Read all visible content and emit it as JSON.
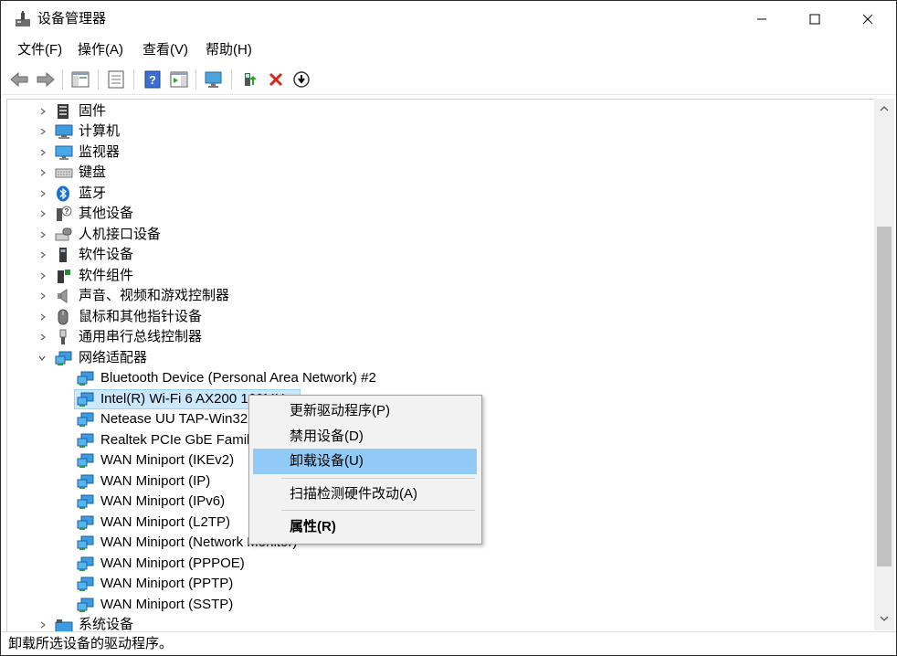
{
  "window": {
    "title": "设备管理器"
  },
  "menu": [
    {
      "label": "文件(F)"
    },
    {
      "label": "操作(A)"
    },
    {
      "label": "查看(V)"
    },
    {
      "label": "帮助(H)"
    }
  ],
  "toolbar": {
    "icons": [
      "back-icon",
      "forward-icon",
      "show-hide-tree-icon",
      "properties-icon",
      "help-icon",
      "action-pane-icon",
      "monitor-scan-icon",
      "update-driver-icon",
      "uninstall-icon",
      "disable-icon"
    ]
  },
  "tree": {
    "categories_top": [
      {
        "label": "固件",
        "icon": "firmware-icon"
      },
      {
        "label": "计算机",
        "icon": "computer-icon"
      },
      {
        "label": "监视器",
        "icon": "monitor-icon"
      },
      {
        "label": "键盘",
        "icon": "keyboard-icon"
      },
      {
        "label": "蓝牙",
        "icon": "bluetooth-icon"
      },
      {
        "label": "其他设备",
        "icon": "unknown-device-icon"
      },
      {
        "label": "人机接口设备",
        "icon": "hid-icon"
      },
      {
        "label": "软件设备",
        "icon": "software-device-icon"
      },
      {
        "label": "软件组件",
        "icon": "software-component-icon"
      },
      {
        "label": "声音、视频和游戏控制器",
        "icon": "speaker-icon"
      },
      {
        "label": "鼠标和其他指针设备",
        "icon": "mouse-icon"
      },
      {
        "label": "通用串行总线控制器",
        "icon": "usb-icon"
      }
    ],
    "network": {
      "label": "网络适配器",
      "children": [
        {
          "label": "Bluetooth Device (Personal Area Network) #2"
        },
        {
          "label": "Intel(R) Wi-Fi 6 AX200 160MHz"
        },
        {
          "label": "Netease UU TAP-Win32 Adapter V9.21"
        },
        {
          "label": "Realtek PCIe GbE Family Controller"
        },
        {
          "label": "WAN Miniport (IKEv2)"
        },
        {
          "label": "WAN Miniport (IP)"
        },
        {
          "label": "WAN Miniport (IPv6)"
        },
        {
          "label": "WAN Miniport (L2TP)"
        },
        {
          "label": "WAN Miniport (Network Monitor)"
        },
        {
          "label": "WAN Miniport (PPPOE)"
        },
        {
          "label": "WAN Miniport (PPTP)"
        },
        {
          "label": "WAN Miniport (SSTP)"
        }
      ]
    },
    "categories_bottom": [
      {
        "label": "系统设备",
        "icon": "system-device-icon"
      }
    ]
  },
  "context_menu": {
    "items": [
      {
        "label": "更新驱动程序(P)"
      },
      {
        "label": "禁用设备(D)"
      },
      {
        "label": "卸载设备(U)"
      },
      {
        "label": "扫描检测硬件改动(A)"
      },
      {
        "label": "属性(R)"
      }
    ]
  },
  "status": {
    "text": "卸载所选设备的驱动程序。"
  },
  "colors": {
    "selection": "#cce8ff",
    "menu_hover": "#91c9f7",
    "accent": "#0078d7"
  }
}
